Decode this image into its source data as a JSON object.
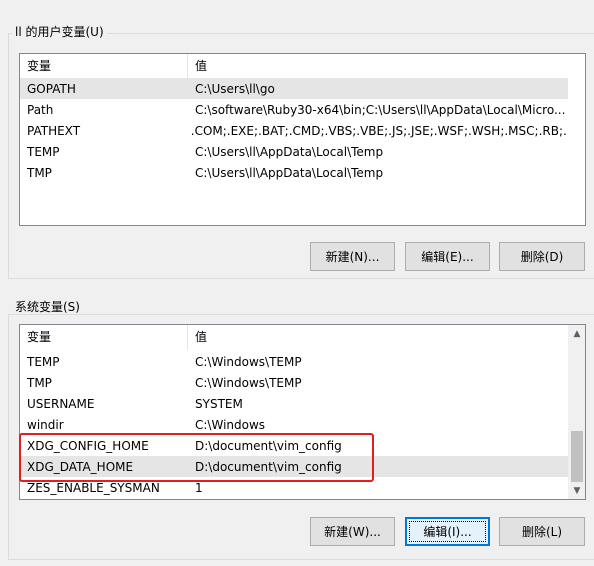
{
  "user_vars": {
    "group_label": "ll 的用户变量(U)",
    "columns": [
      "变量",
      "值"
    ],
    "rows": [
      {
        "name": "GOPATH",
        "value": "C:\\Users\\ll\\go"
      },
      {
        "name": "Path",
        "value": "C:\\software\\Ruby30-x64\\bin;C:\\Users\\ll\\AppData\\Local\\Micro..."
      },
      {
        "name": "PATHEXT",
        "value": ".COM;.EXE;.BAT;.CMD;.VBS;.VBE;.JS;.JSE;.WSF;.WSH;.MSC;.RB;...."
      },
      {
        "name": "TEMP",
        "value": "C:\\Users\\ll\\AppData\\Local\\Temp"
      },
      {
        "name": "TMP",
        "value": "C:\\Users\\ll\\AppData\\Local\\Temp"
      }
    ],
    "buttons": {
      "new": "新建(N)...",
      "edit": "编辑(E)...",
      "delete": "删除(D)"
    }
  },
  "system_vars": {
    "group_label": "系统变量(S)",
    "columns": [
      "变量",
      "值"
    ],
    "rows": [
      {
        "name": "TEMP",
        "value": "C:\\Windows\\TEMP"
      },
      {
        "name": "TMP",
        "value": "C:\\Windows\\TEMP"
      },
      {
        "name": "USERNAME",
        "value": "SYSTEM"
      },
      {
        "name": "windir",
        "value": "C:\\Windows"
      },
      {
        "name": "XDG_CONFIG_HOME",
        "value": "D:\\document\\vim_config"
      },
      {
        "name": "XDG_DATA_HOME",
        "value": "D:\\document\\vim_config"
      },
      {
        "name": "ZES_ENABLE_SYSMAN",
        "value": "1"
      }
    ],
    "buttons": {
      "new": "新建(W)...",
      "edit": "编辑(I)...",
      "delete": "删除(L)"
    }
  },
  "colors": {
    "highlight": "#e02020",
    "default_button_border": "#0078d7"
  }
}
